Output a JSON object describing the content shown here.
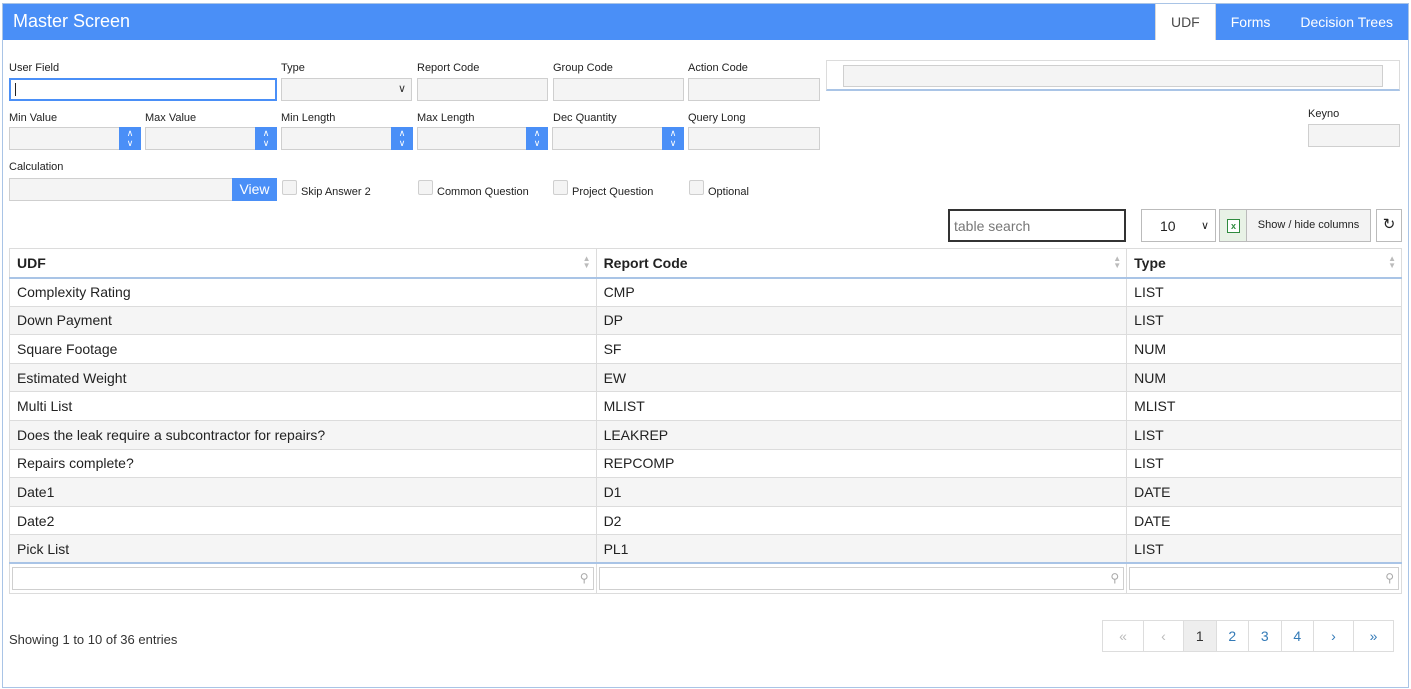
{
  "header": {
    "title": "Master Screen",
    "tabs": [
      {
        "label": "UDF"
      },
      {
        "label": "Forms"
      },
      {
        "label": "Decision Trees"
      }
    ]
  },
  "form": {
    "user_field": "User Field",
    "type": "Type",
    "report_code": "Report Code",
    "group_code": "Group Code",
    "action_code": "Action Code",
    "min_value": "Min Value",
    "max_value": "Max Value",
    "min_length": "Min Length",
    "max_length": "Max Length",
    "dec_quantity": "Dec Quantity",
    "query_long": "Query Long",
    "keyno": "Keyno",
    "calculation": "Calculation",
    "view_button": "View",
    "skip_answer": "Skip Answer 2",
    "common_question": "Common Question",
    "project_question": "Project Question",
    "optional": "Optional"
  },
  "toolbar": {
    "search_placeholder": "table search",
    "page_length": "10",
    "show_hide_columns": "Show / hide columns",
    "excel_glyph": "x"
  },
  "table": {
    "columns": [
      "UDF",
      "Report Code",
      "Type"
    ],
    "rows": [
      [
        "Complexity Rating",
        "CMP",
        "LIST"
      ],
      [
        "Down Payment",
        "DP",
        "LIST"
      ],
      [
        "Square Footage",
        "SF",
        "NUM"
      ],
      [
        "Estimated Weight",
        "EW",
        "NUM"
      ],
      [
        "Multi List",
        "MLIST",
        "MLIST"
      ],
      [
        "Does the leak require a subcontractor for repairs?",
        "LEAKREP",
        "LIST"
      ],
      [
        "Repairs complete?",
        "REPCOMP",
        "LIST"
      ],
      [
        "Date1",
        "D1",
        "DATE"
      ],
      [
        "Date2",
        "D2",
        "DATE"
      ],
      [
        "Pick List",
        "PL1",
        "LIST"
      ]
    ]
  },
  "footer": {
    "info": "Showing 1 to 10 of 36 entries",
    "pages": [
      "«",
      "‹",
      "1",
      "2",
      "3",
      "4",
      "›",
      "»"
    ]
  }
}
